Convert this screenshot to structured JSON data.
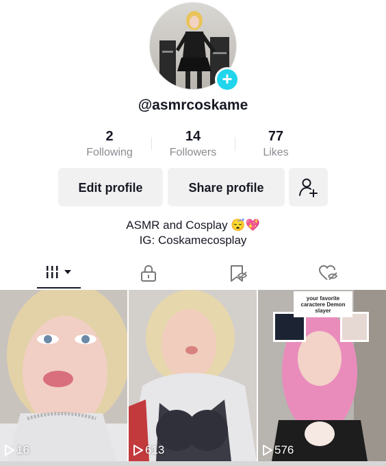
{
  "profile": {
    "username": "@asmrcoskame",
    "add_icon_glyph": "+"
  },
  "stats": [
    {
      "value": "2",
      "label": "Following"
    },
    {
      "value": "14",
      "label": "Followers"
    },
    {
      "value": "77",
      "label": "Likes"
    }
  ],
  "actions": {
    "edit_label": "Edit profile",
    "share_label": "Share profile",
    "add_friend_icon": "person-add-icon"
  },
  "bio": {
    "line1": "ASMR and Cosplay",
    "emoji": "😴💖",
    "line2": "IG: Coskamecosplay"
  },
  "tabs": [
    {
      "icon": "grid-icon",
      "active": true
    },
    {
      "icon": "lock-icon",
      "active": false
    },
    {
      "icon": "bookmark-hidden-icon",
      "active": false
    },
    {
      "icon": "heart-hidden-icon",
      "active": false
    }
  ],
  "videos": [
    {
      "views": "16"
    },
    {
      "views": "613"
    },
    {
      "views": "576",
      "caption": "your favorite caractere Demon slayer"
    }
  ],
  "colors": {
    "accent": "#20d5ec",
    "button_bg": "#f1f1f2",
    "text": "#161823",
    "muted": "#8a8b91"
  }
}
